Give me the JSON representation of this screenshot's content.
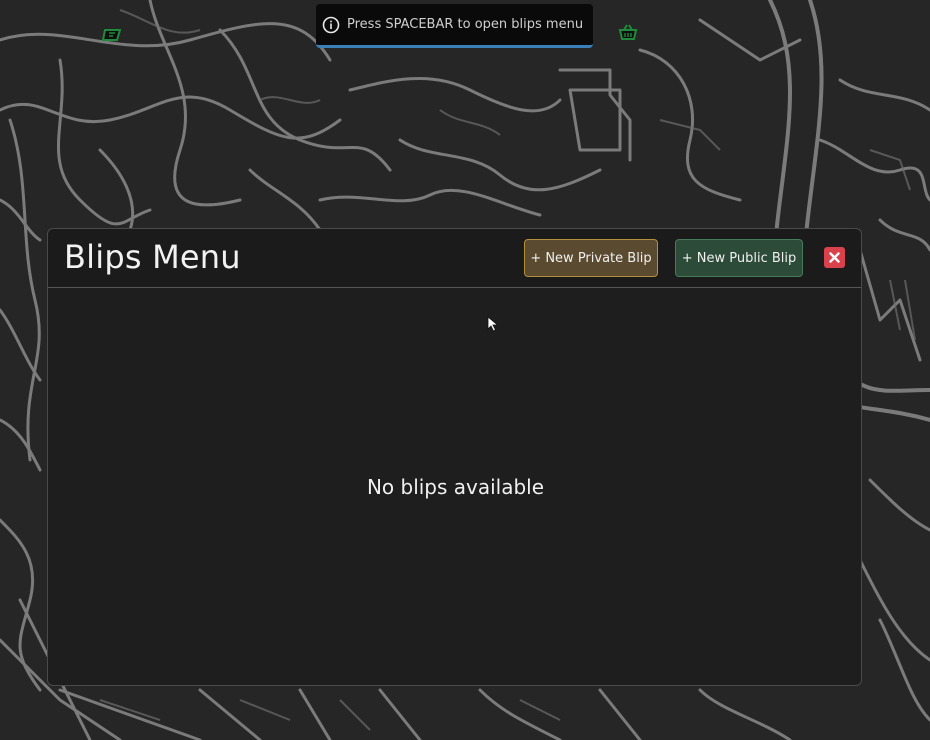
{
  "notification": {
    "text": "Press SPACEBAR to open blips menu",
    "icon": "info-icon",
    "accent_color": "#3b7fb8"
  },
  "map": {
    "icons": [
      "map-marker-icon",
      "basket-icon"
    ],
    "marker_color": "#1f8a3a"
  },
  "blips_menu": {
    "title": "Blips Menu",
    "new_private_label": "+ New Private Blip",
    "new_public_label": "+ New Public Blip",
    "close_icon": "close-icon",
    "empty_message": "No blips available",
    "colors": {
      "private_button": "#5a4a2f",
      "public_button": "#2c4b39",
      "close_button": "#d9424d"
    }
  }
}
